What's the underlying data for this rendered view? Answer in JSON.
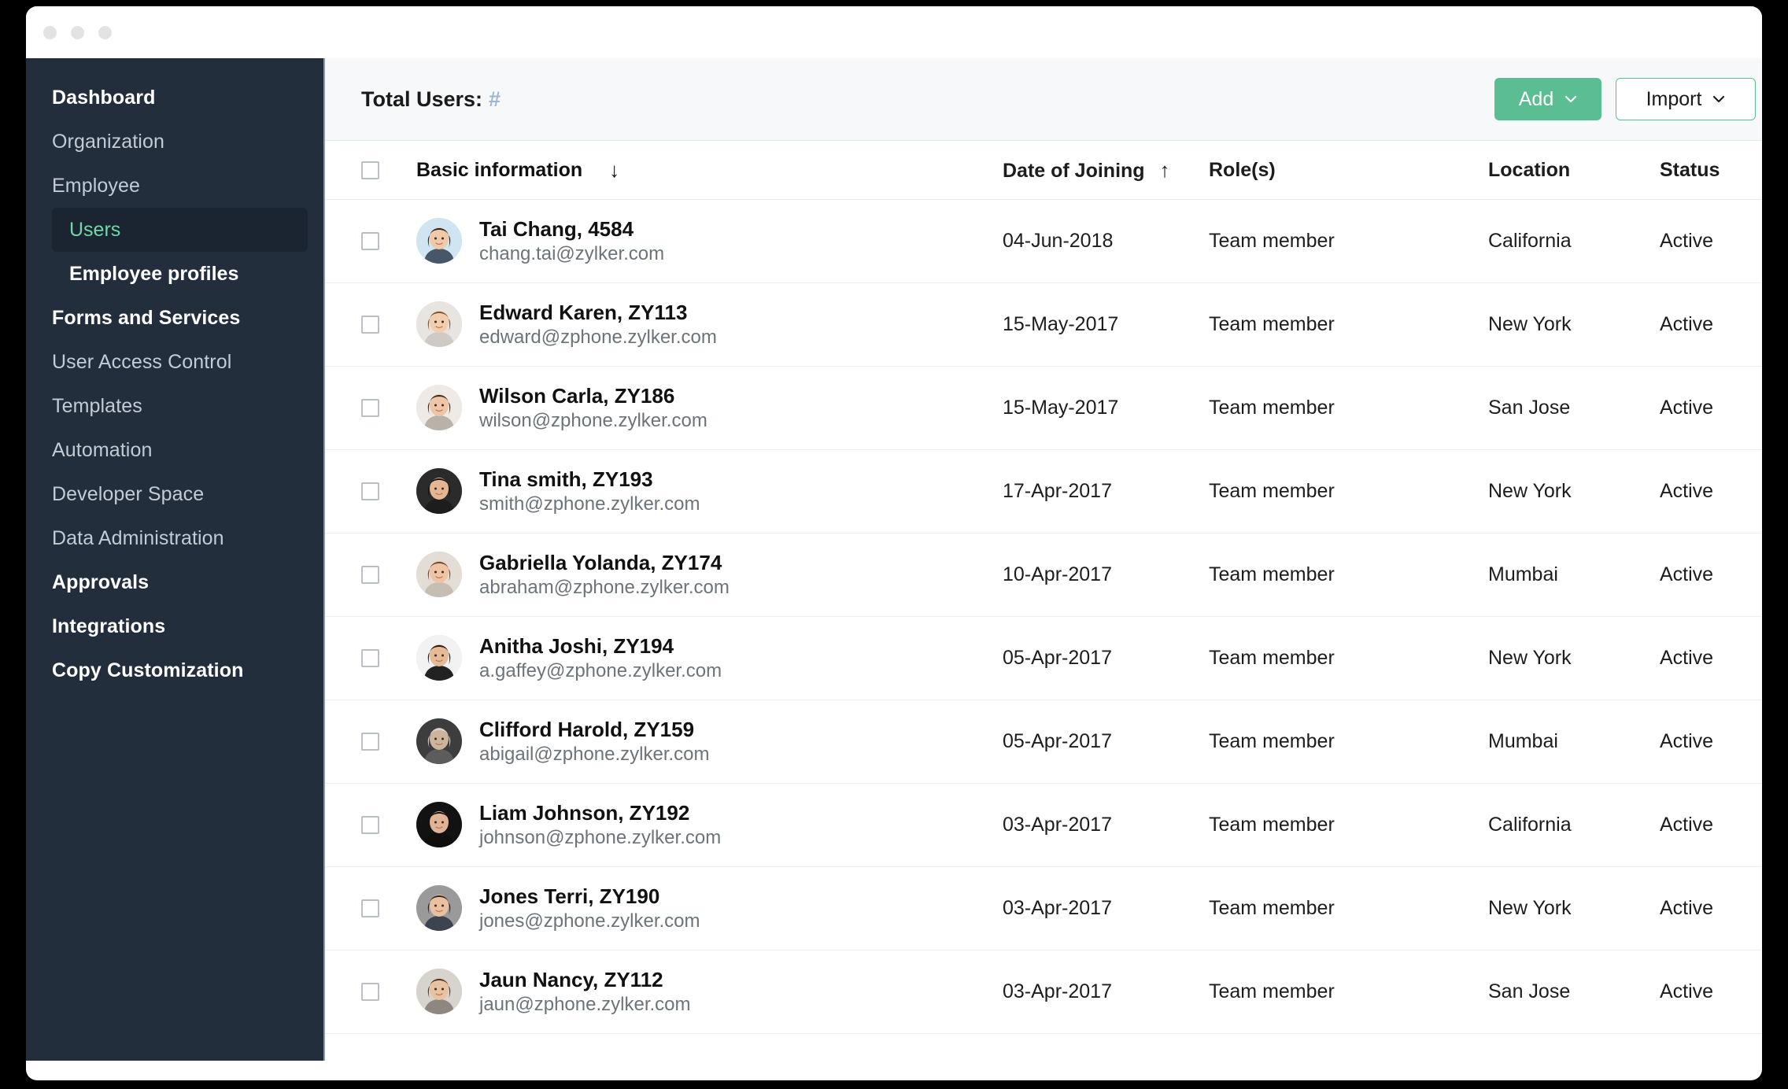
{
  "window": {
    "dots": [
      "close-dot",
      "minimize-dot",
      "maximize-dot"
    ]
  },
  "sidebar": {
    "items": [
      {
        "label": "Dashboard",
        "type": "top",
        "strong": true
      },
      {
        "label": "Organization",
        "type": "top",
        "strong": false
      },
      {
        "label": "Employee",
        "type": "top",
        "strong": false
      },
      {
        "label": "Users",
        "type": "sub",
        "active": true
      },
      {
        "label": "Employee profiles",
        "type": "sub",
        "strong": true
      },
      {
        "label": "Forms and Services",
        "type": "top",
        "strong": true
      },
      {
        "label": "User Access Control",
        "type": "top",
        "strong": false
      },
      {
        "label": "Templates",
        "type": "top",
        "strong": false
      },
      {
        "label": "Automation",
        "type": "top",
        "strong": false
      },
      {
        "label": "Developer Space",
        "type": "top",
        "strong": false
      },
      {
        "label": "Data Administration",
        "type": "top",
        "strong": false
      },
      {
        "label": "Approvals",
        "type": "top",
        "strong": true
      },
      {
        "label": "Integrations",
        "type": "top",
        "strong": true
      },
      {
        "label": "Copy Customization",
        "type": "top",
        "strong": true
      }
    ]
  },
  "toolbar": {
    "total_users_label": "Total Users:",
    "total_users_value": "#",
    "add_label": "Add",
    "import_label": "Import"
  },
  "table": {
    "columns": {
      "basic": "Basic information",
      "basic_sort": "↓",
      "date": "Date of Joining",
      "date_sort": "↑",
      "role": "Role(s)",
      "location": "Location",
      "status": "Status"
    },
    "rows": [
      {
        "name": "Tai Chang, 4584",
        "email": "chang.tai@zylker.com",
        "date": "04-Jun-2018",
        "role": "Team member",
        "location": "California",
        "status": "Active",
        "avatar": "avatar-tai-chang"
      },
      {
        "name": "Edward Karen, ZY113",
        "email": "edward@zphone.zylker.com",
        "date": "15-May-2017",
        "role": "Team member",
        "location": "New York",
        "status": "Active",
        "avatar": "avatar-edward-karen"
      },
      {
        "name": "Wilson Carla, ZY186",
        "email": "wilson@zphone.zylker.com",
        "date": "15-May-2017",
        "role": "Team member",
        "location": "San Jose",
        "status": "Active",
        "avatar": "avatar-wilson-carla"
      },
      {
        "name": "Tina smith, ZY193",
        "email": "smith@zphone.zylker.com",
        "date": "17-Apr-2017",
        "role": "Team member",
        "location": "New York",
        "status": "Active",
        "avatar": "avatar-tina-smith"
      },
      {
        "name": "Gabriella Yolanda, ZY174",
        "email": "abraham@zphone.zylker.com",
        "date": "10-Apr-2017",
        "role": "Team member",
        "location": "Mumbai",
        "status": "Active",
        "avatar": "avatar-gabriella-yolanda"
      },
      {
        "name": "Anitha Joshi, ZY194",
        "email": "a.gaffey@zphone.zylker.com",
        "date": "05-Apr-2017",
        "role": "Team member",
        "location": "New York",
        "status": "Active",
        "avatar": "avatar-anitha-joshi"
      },
      {
        "name": "Clifford Harold, ZY159",
        "email": "abigail@zphone.zylker.com",
        "date": "05-Apr-2017",
        "role": "Team member",
        "location": "Mumbai",
        "status": "Active",
        "avatar": "avatar-clifford-harold"
      },
      {
        "name": "Liam Johnson, ZY192",
        "email": "johnson@zphone.zylker.com",
        "date": "03-Apr-2017",
        "role": "Team member",
        "location": "California",
        "status": "Active",
        "avatar": "avatar-liam-johnson"
      },
      {
        "name": "Jones Terri, ZY190",
        "email": "jones@zphone.zylker.com",
        "date": "03-Apr-2017",
        "role": "Team member",
        "location": "New York",
        "status": "Active",
        "avatar": "avatar-jones-terri"
      },
      {
        "name": "Jaun Nancy, ZY112",
        "email": "jaun@zphone.zylker.com",
        "date": "03-Apr-2017",
        "role": "Team member",
        "location": "San Jose",
        "status": "Active",
        "avatar": "avatar-jaun-nancy"
      }
    ]
  },
  "colors": {
    "sidebar_bg": "#222e3c",
    "sidebar_active_text": "#72d6a5",
    "accent_green": "#5bbd92",
    "toolbar_bg": "#f7f8f9",
    "hash_blue": "#9fb6d4"
  }
}
